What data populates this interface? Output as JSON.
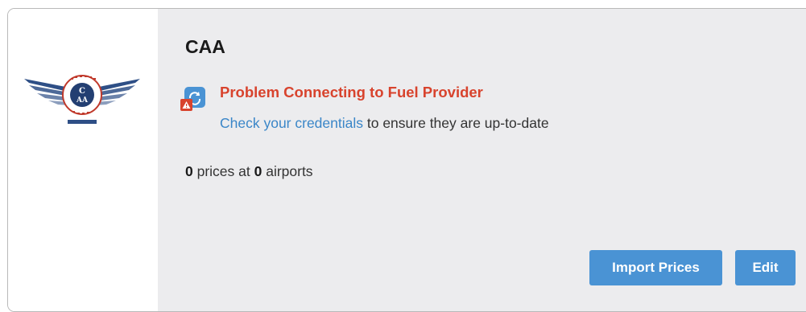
{
  "provider": {
    "name": "CAA",
    "logo_icon": "caa-winged-logo"
  },
  "status": {
    "icon": "sync-error-icon",
    "title": "Problem Connecting to Fuel Provider",
    "link_text": "Check your credentials",
    "message_rest": " to ensure they are up-to-date"
  },
  "summary": {
    "prices_count": "0",
    "prices_label": " prices at ",
    "airports_count": "0",
    "airports_label": " airports"
  },
  "actions": {
    "import_label": "Import Prices",
    "edit_label": "Edit"
  },
  "colors": {
    "error": "#d8432d",
    "link": "#3a86c8",
    "button": "#4a93d4",
    "panel": "#ececee"
  }
}
